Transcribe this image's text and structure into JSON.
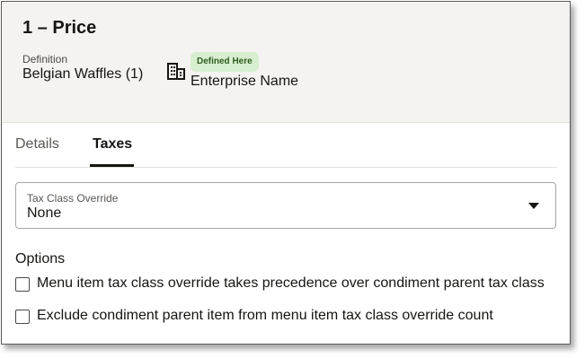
{
  "header": {
    "title": "1 – Price",
    "definition_label": "Definition",
    "definition_value": "Belgian Waffles (1)",
    "badge": "Defined Here",
    "enterprise_name": "Enterprise Name",
    "building_icon": "building-icon"
  },
  "tabs": [
    {
      "label": "Details",
      "active": false
    },
    {
      "label": "Taxes",
      "active": true
    }
  ],
  "tax_class_override": {
    "label": "Tax Class Override",
    "value": "None",
    "caret_icon": "caret-down-icon"
  },
  "options": {
    "label": "Options",
    "items": [
      {
        "label": "Menu item tax class override takes precedence over condiment parent tax class",
        "checked": false
      },
      {
        "label": "Exclude condiment parent item from menu item tax class override count",
        "checked": false
      }
    ]
  },
  "colors": {
    "header_bg": "#f5f3f1",
    "badge_bg": "#d8eed0",
    "badge_text": "#2f5d1f",
    "text": "#161513"
  }
}
